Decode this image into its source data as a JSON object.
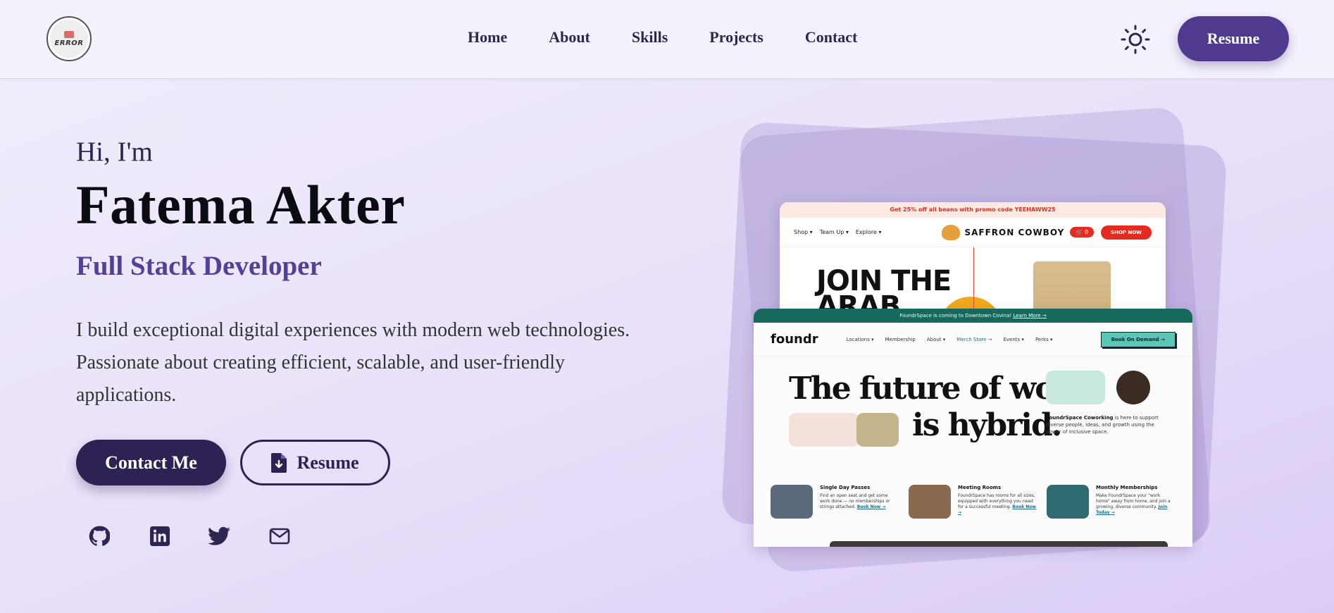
{
  "nav": {
    "logo_text": "ERROR",
    "links": [
      "Home",
      "About",
      "Skills",
      "Projects",
      "Contact"
    ],
    "theme_icon": "sun-icon",
    "resume_label": "Resume"
  },
  "hero": {
    "greeting": "Hi, I'm",
    "name": "Fatema Akter",
    "role": "Full Stack Developer",
    "bio": "I build exceptional digital experiences with modern web technologies. Passionate about creating efficient, scalable, and user-friendly applications.",
    "contact_label": "Contact Me",
    "resume_label": "Resume",
    "socials": [
      "github-icon",
      "linkedin-icon",
      "twitter-icon",
      "mail-icon"
    ]
  },
  "showcase": {
    "saffron": {
      "promo": "Get 25% off all beans with promo code YEEHAWW25",
      "menu": [
        "Shop ▾",
        "Team Up ▾",
        "Explore ▾"
      ],
      "brand": "SAFFRON COWBOY",
      "cart": "0",
      "shop_now": "SHOP NOW",
      "headline_1": "JOIN THE",
      "headline_2": "ARAB"
    },
    "foundr": {
      "banner": "FoundrSpace is coming to Downtown Covina!",
      "banner_link": "Learn More →",
      "logo": "foundr",
      "links": [
        "Locations ▾",
        "Membership",
        "About ▾",
        "Merch Store →",
        "Events ▾",
        "Perks ▾"
      ],
      "book": "Book On Demand →",
      "headline_1": "The future of work",
      "headline_2": "is hybrid.",
      "desc_bold": "FoundrSpace Coworking",
      "desc_rest": " is here to support diverse people, ideas, and growth using the power of inclusive space.",
      "cards": [
        {
          "title": "Single Day Passes",
          "text": "Find an open seat and get some work done — no memberships or strings attached.",
          "link": "Book Now →"
        },
        {
          "title": "Meeting Rooms",
          "text": "FoundrSpace has rooms for all sizes, equipped with everything you need for a successful meeting.",
          "link": "Book Now →"
        },
        {
          "title": "Monthly Memberships",
          "text": "Make FoundrSpace your \"work home\" away from home, and join a growing, diverse community.",
          "link": "Join Today →"
        }
      ]
    }
  },
  "colors": {
    "accent": "#4f3a8f",
    "dark": "#2d2253",
    "role": "#553f98"
  }
}
